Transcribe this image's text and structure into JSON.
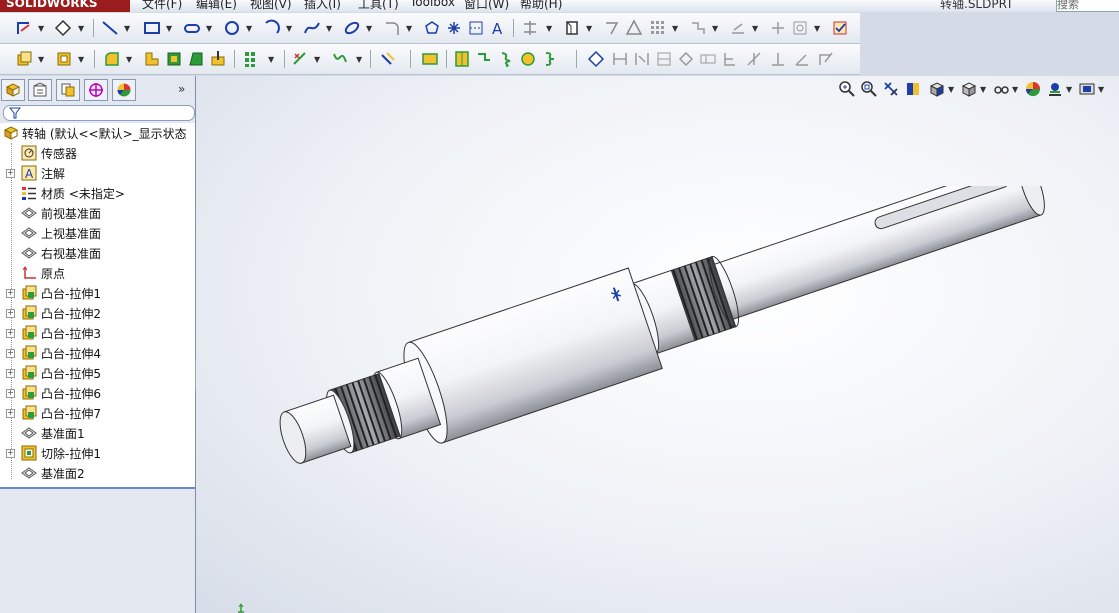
{
  "app": {
    "logo": "SOLIDWORKS",
    "menus": [
      "文件(F)",
      "编辑(E)",
      "视图(V)",
      "插入(I)",
      "工具(T)",
      "Toolbox",
      "窗口(W)",
      "帮助(H)"
    ],
    "document_title": "转轴.SLDPRT",
    "search_placeholder": "搜索"
  },
  "panel": {
    "tabs": [
      "feature-manager-icon",
      "property-manager-icon",
      "configuration-manager-icon",
      "dimxpert-icon",
      "display-manager-icon"
    ],
    "more": "»",
    "tree": [
      {
        "label": "转轴  (默认<<默认>_显示状态",
        "icon": "part-icon",
        "expand": false,
        "root": true
      },
      {
        "label": "传感器",
        "icon": "sensor-icon",
        "expand": false
      },
      {
        "label": "注解",
        "icon": "annotation-icon",
        "expand": true
      },
      {
        "label": "材质 <未指定>",
        "icon": "material-icon",
        "expand": false
      },
      {
        "label": "前视基准面",
        "icon": "plane-icon",
        "expand": false
      },
      {
        "label": "上视基准面",
        "icon": "plane-icon",
        "expand": false
      },
      {
        "label": "右视基准面",
        "icon": "plane-icon",
        "expand": false
      },
      {
        "label": "原点",
        "icon": "origin-icon",
        "expand": false
      },
      {
        "label": "凸台-拉伸1",
        "icon": "boss-extrude-icon",
        "expand": true
      },
      {
        "label": "凸台-拉伸2",
        "icon": "boss-extrude-icon",
        "expand": true
      },
      {
        "label": "凸台-拉伸3",
        "icon": "boss-extrude-icon",
        "expand": true
      },
      {
        "label": "凸台-拉伸4",
        "icon": "boss-extrude-icon",
        "expand": true
      },
      {
        "label": "凸台-拉伸5",
        "icon": "boss-extrude-icon",
        "expand": true
      },
      {
        "label": "凸台-拉伸6",
        "icon": "boss-extrude-icon",
        "expand": true
      },
      {
        "label": "凸台-拉伸7",
        "icon": "boss-extrude-icon",
        "expand": true
      },
      {
        "label": "基准面1",
        "icon": "plane-icon",
        "expand": false
      },
      {
        "label": "切除-拉伸1",
        "icon": "cut-extrude-icon",
        "expand": true
      },
      {
        "label": "基准面2",
        "icon": "plane-icon",
        "expand": false
      }
    ]
  },
  "colors": {
    "accent_blue": "#1b3fa8",
    "feature_yellow": "#f2c12e",
    "feature_green": "#2e9b3a",
    "shaft_light": "#f7f7f8",
    "shaft_dark": "#8c8f95"
  }
}
